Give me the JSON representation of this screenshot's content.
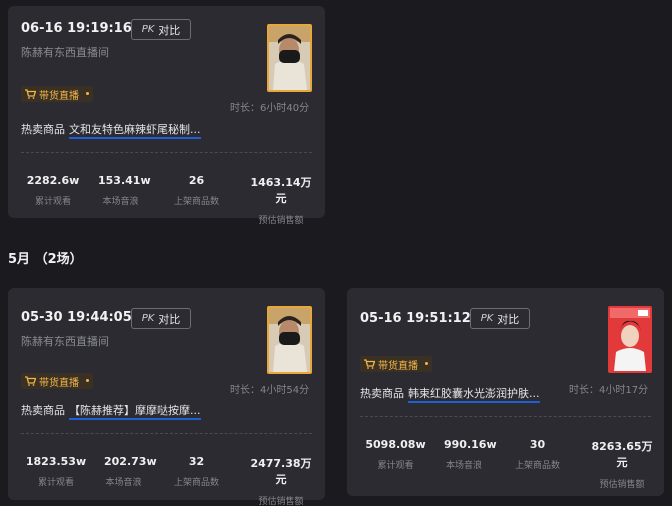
{
  "month_header": "5月 （2场）",
  "cards": [
    {
      "time": "06-16 19:19:16",
      "room": "陈赫有东西直播间",
      "pk_label": "对比",
      "pk_icon": "PK",
      "badge": "带货直播",
      "duration": "时长：6小时40分",
      "product_prefix": "热卖商品",
      "product_name": "文和友特色麻辣虾尾秘制...",
      "stats": [
        {
          "value": "2282.6w",
          "label": "累计观看"
        },
        {
          "value": "153.41w",
          "label": "本场音浪"
        },
        {
          "value": "26",
          "label": "上架商品数"
        },
        {
          "value": "1463.14万元",
          "label": "预估销售额"
        }
      ]
    },
    {
      "time": "05-30 19:44:05",
      "room": "陈赫有东西直播间",
      "pk_label": "对比",
      "pk_icon": "PK",
      "badge": "带货直播",
      "duration": "时长：4小时54分",
      "product_prefix": "热卖商品",
      "product_name": "【陈赫推荐】摩摩哒按摩...",
      "stats": [
        {
          "value": "1823.53w",
          "label": "累计观看"
        },
        {
          "value": "202.73w",
          "label": "本场音浪"
        },
        {
          "value": "32",
          "label": "上架商品数"
        },
        {
          "value": "2477.38万元",
          "label": "预估销售额"
        }
      ]
    },
    {
      "time": "05-16 19:51:12",
      "room": "",
      "pk_label": "对比",
      "pk_icon": "PK",
      "badge": "带货直播",
      "duration": "时长：4小时17分",
      "product_prefix": "热卖商品",
      "product_name": "韩束红胶囊水光澎润护肤...",
      "stats": [
        {
          "value": "5098.08w",
          "label": "累计观看"
        },
        {
          "value": "990.16w",
          "label": "本场音浪"
        },
        {
          "value": "30",
          "label": "上架商品数"
        },
        {
          "value": "8263.65万元",
          "label": "预估销售额"
        }
      ]
    }
  ],
  "icons": {
    "cart": "shopping-cart-icon",
    "pk": "pk-icon"
  },
  "colors": {
    "background": "#1b1b1f",
    "card": "#2b2b31",
    "badge_text": "#f2b74a",
    "link_underline": "#1e5fd8",
    "thumb_border": "#e8a73a"
  }
}
